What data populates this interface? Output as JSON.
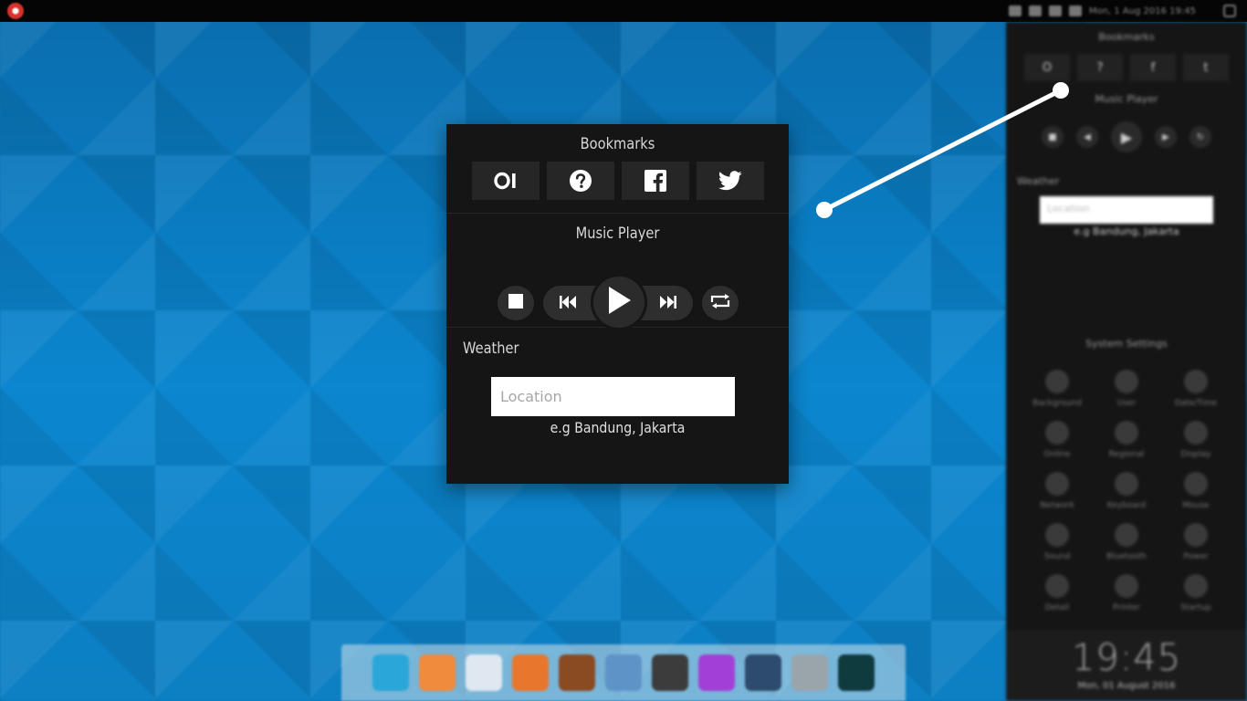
{
  "topbar": {
    "datetime": "Mon, 1 Aug 2016 19:45"
  },
  "panel": {
    "bookmarks": {
      "title": "Bookmarks",
      "items": [
        {
          "name": "opera-icon"
        },
        {
          "name": "help-icon"
        },
        {
          "name": "facebook-icon"
        },
        {
          "name": "twitter-icon"
        }
      ]
    },
    "music": {
      "title": "Music Player",
      "controls": [
        "stop",
        "previous",
        "play",
        "next",
        "repeat"
      ]
    },
    "weather": {
      "title": "Weather",
      "placeholder": "Location",
      "hint": "e.g Bandung, Jakarta"
    }
  },
  "sidebar": {
    "bookmarks_title": "Bookmarks",
    "music_title": "Music Player",
    "weather_title": "Weather",
    "weather_placeholder": "Location",
    "weather_hint": "e.g Bandung, Jakarta",
    "settings_title": "System Settings",
    "settings": [
      "Background",
      "User",
      "Date/Time",
      "Online",
      "Regional",
      "Display",
      "Network",
      "Keyboard",
      "Mouse",
      "Sound",
      "Bluetooth",
      "Power",
      "Detail",
      "Printer",
      "Startup"
    ],
    "clock_time": "19:45",
    "clock_date": "Mon, 01 August 2016"
  },
  "dock": {
    "items": [
      {
        "name": "chrome-icon",
        "color": "#2aa7d8"
      },
      {
        "name": "files-stack-icon",
        "color": "#f08a3c"
      },
      {
        "name": "folder-icon",
        "color": "#dfe8f0"
      },
      {
        "name": "firefox-icon",
        "color": "#e8762c"
      },
      {
        "name": "guitar-icon",
        "color": "#8a4a22"
      },
      {
        "name": "package-icon",
        "color": "#5e93c8"
      },
      {
        "name": "screenshot-icon",
        "color": "#3c3c3c"
      },
      {
        "name": "chat-icon",
        "color": "#a23fd6"
      },
      {
        "name": "camera-icon",
        "color": "#2d4b6c"
      },
      {
        "name": "calculator-icon",
        "color": "#9aa4ab"
      },
      {
        "name": "terminal-icon",
        "color": "#0f3a3e"
      }
    ]
  },
  "colors": {
    "panel_bg": "#151515",
    "button_bg": "#262626",
    "accent_wallpaper": "#0b86cf"
  }
}
